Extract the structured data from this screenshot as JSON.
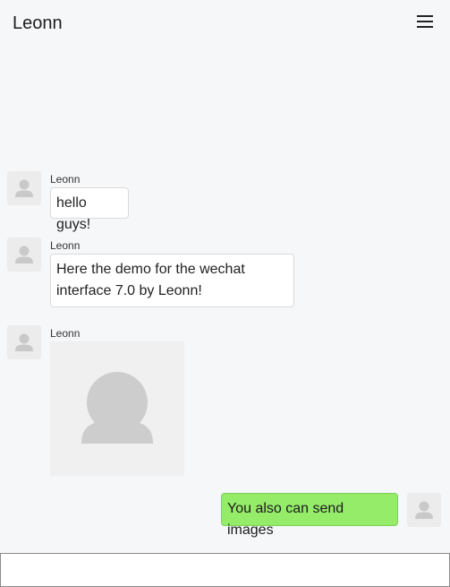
{
  "header": {
    "title": "Leonn",
    "menu_icon": "hamburger-menu-icon"
  },
  "messages": [
    {
      "sender": "Leonn",
      "text": "hello guys!",
      "type": "text",
      "side": "left"
    },
    {
      "sender": "Leonn",
      "text_line1": "Here the demo for the wechat",
      "text_line2": "interface 7.0 by Leonn!",
      "type": "text",
      "side": "left"
    },
    {
      "sender": "Leonn",
      "type": "image",
      "image_icon": "user-silhouette-icon",
      "side": "left"
    },
    {
      "text": "You also can send images",
      "type": "text",
      "side": "right"
    }
  ],
  "colors": {
    "background": "#f6f7f9",
    "self_bubble": "#95ec69",
    "other_bubble": "#ffffff"
  },
  "input": {
    "value": "",
    "placeholder": ""
  }
}
